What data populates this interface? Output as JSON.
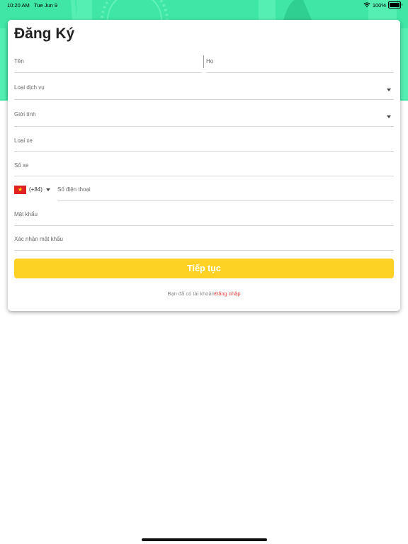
{
  "status_bar": {
    "time": "10:20 AM",
    "date": "Tue Jun 9",
    "battery_text": "100%",
    "battery_level": 1.0,
    "icons": [
      "wifi-icon",
      "battery-icon"
    ]
  },
  "colors": {
    "header_bg": "#3fe6a6",
    "primary_button": "#fdd225",
    "link": "#e43b3b"
  },
  "form": {
    "title": "Đăng Ký",
    "first_name_placeholder": "Tên",
    "last_name_placeholder": "Họ",
    "service_type_placeholder": "Loại dịch vụ",
    "gender_placeholder": "Giới tính",
    "vehicle_type_placeholder": "Loại xe",
    "vehicle_number_placeholder": "Số xe",
    "country_code": "(+84)",
    "phone_placeholder": "Số điện thoại",
    "password_placeholder": "Mật khẩu",
    "confirm_password_placeholder": "Xác nhận mật khẩu",
    "continue_label": "Tiếp tục",
    "have_account_text": "Bạn đã có tài khoản",
    "login_link": "Đăng nhập"
  }
}
